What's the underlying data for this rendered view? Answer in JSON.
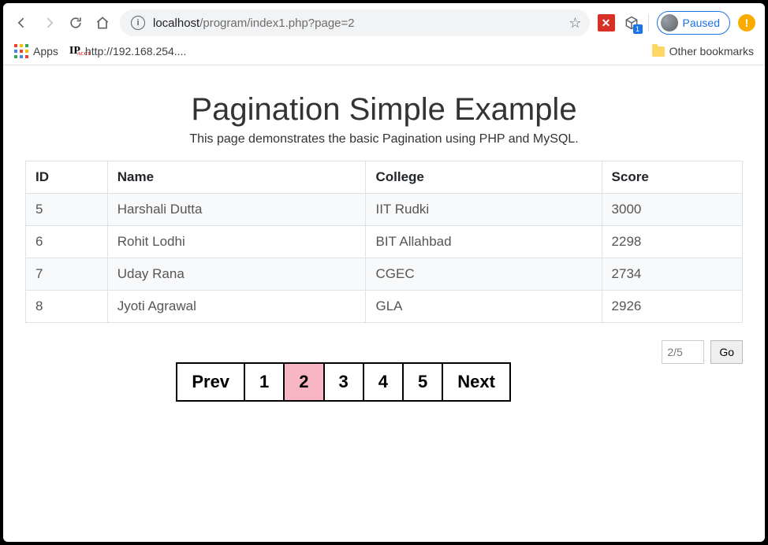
{
  "browser": {
    "url_host": "localhost",
    "url_path": "/program/index1.php?page=2",
    "extension_badge": "1",
    "profile_label": "Paused",
    "alert_glyph": "!"
  },
  "bookmarks": {
    "apps_label": "Apps",
    "items": [
      {
        "label": "http://192.168.254...."
      }
    ],
    "other_label": "Other bookmarks"
  },
  "page": {
    "title": "Pagination Simple Example",
    "subtitle": "This page demonstrates the basic Pagination using PHP and MySQL."
  },
  "table": {
    "headers": [
      "ID",
      "Name",
      "College",
      "Score"
    ],
    "rows": [
      {
        "id": "5",
        "name": "Harshali Dutta",
        "college": "IIT Rudki",
        "score": "3000"
      },
      {
        "id": "6",
        "name": "Rohit Lodhi",
        "college": "BIT Allahbad",
        "score": "2298"
      },
      {
        "id": "7",
        "name": "Uday Rana",
        "college": "CGEC",
        "score": "2734"
      },
      {
        "id": "8",
        "name": "Jyoti Agrawal",
        "college": "GLA",
        "score": "2926"
      }
    ]
  },
  "pagination": {
    "prev_label": "Prev",
    "next_label": "Next",
    "pages": [
      "1",
      "2",
      "3",
      "4",
      "5"
    ],
    "active_index": 1
  },
  "goto": {
    "placeholder": "2/5",
    "button_label": "Go"
  }
}
